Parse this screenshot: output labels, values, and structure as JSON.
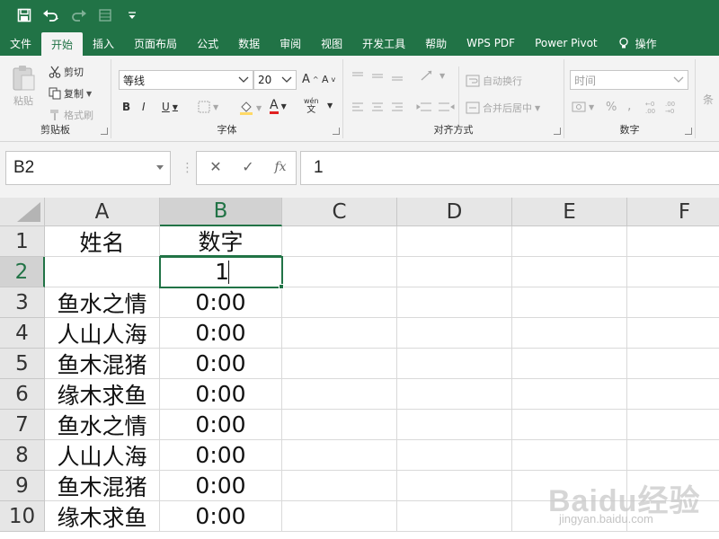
{
  "colors": {
    "accent": "#217346",
    "ribbon_bg": "#f3f3f3",
    "header_bg": "#e6e6e6",
    "header_selected_bg": "#d2d2d2",
    "gridline": "#d9d9d9"
  },
  "qat": {
    "icons": [
      "save-icon",
      "undo-icon",
      "redo-icon",
      "form-icon",
      "customize-qat-icon"
    ]
  },
  "tabs": [
    {
      "label": "文件"
    },
    {
      "label": "开始",
      "active": true
    },
    {
      "label": "插入"
    },
    {
      "label": "页面布局"
    },
    {
      "label": "公式"
    },
    {
      "label": "数据"
    },
    {
      "label": "审阅"
    },
    {
      "label": "视图"
    },
    {
      "label": "开发工具"
    },
    {
      "label": "帮助"
    },
    {
      "label": "WPS PDF"
    },
    {
      "label": "Power Pivot"
    },
    {
      "label": "操作"
    }
  ],
  "ribbon": {
    "clipboard": {
      "paste": "粘贴",
      "cut": "剪切",
      "copy": "复制",
      "format_painter": "格式刷",
      "label": "剪贴板"
    },
    "font": {
      "font_name": "等线",
      "font_size": "20",
      "grow": "A",
      "shrink": "A",
      "bold": "B",
      "italic": "I",
      "underline": "U",
      "font_color": "A",
      "wen": "wén",
      "wen_char": "文",
      "label": "字体"
    },
    "alignment": {
      "wrap_text": "自动换行",
      "merge_center": "合并后居中",
      "label": "对齐方式"
    },
    "number": {
      "format": "时间",
      "percent": "%",
      "comma": ",",
      "label": "数字"
    },
    "styles": {
      "conditional": "条"
    }
  },
  "formula_bar": {
    "name_box": "B2",
    "cancel": "✕",
    "enter": "✓",
    "fx": "fx",
    "content": "1"
  },
  "sheet": {
    "columns": [
      "A",
      "B",
      "C",
      "D",
      "E",
      "F"
    ],
    "selected_column": "B",
    "selected_row": "2",
    "active_cell": "B2",
    "rows": [
      {
        "row": "1",
        "a": "姓名",
        "b": "数字"
      },
      {
        "row": "2",
        "a": "",
        "b": "1"
      },
      {
        "row": "3",
        "a": "鱼水之情",
        "b": "0:00"
      },
      {
        "row": "4",
        "a": "人山人海",
        "b": "0:00"
      },
      {
        "row": "5",
        "a": "鱼木混猪",
        "b": "0:00"
      },
      {
        "row": "6",
        "a": "缘木求鱼",
        "b": "0:00"
      },
      {
        "row": "7",
        "a": "鱼水之情",
        "b": "0:00"
      },
      {
        "row": "8",
        "a": "人山人海",
        "b": "0:00"
      },
      {
        "row": "9",
        "a": "鱼木混猪",
        "b": "0:00"
      },
      {
        "row": "10",
        "a": "缘木求鱼",
        "b": "0:00"
      }
    ]
  },
  "watermark": {
    "text": "Baidu经验",
    "sub": "jingyan.baidu.com"
  }
}
